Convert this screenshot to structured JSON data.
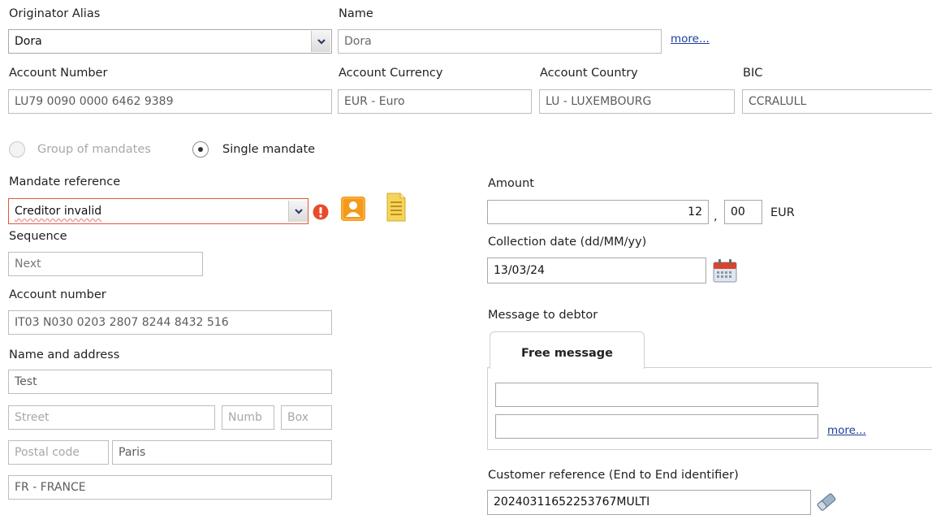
{
  "originator": {
    "alias_label": "Originator Alias",
    "alias_value": "Dora",
    "name_label": "Name",
    "name_value": "Dora",
    "more_link": "more..."
  },
  "account": {
    "number_label": "Account Number",
    "number_value": "LU79 0090 0000 6462 9389",
    "currency_label": "Account Currency",
    "currency_value": "EUR - Euro",
    "country_label": "Account Country",
    "country_value": "LU - LUXEMBOURG",
    "bic_label": "BIC",
    "bic_value": "CCRALULL"
  },
  "mandate_type": {
    "group_label": "Group of mandates",
    "single_label": "Single mandate",
    "selected": "single"
  },
  "mandate": {
    "reference_label": "Mandate reference",
    "reference_value": "Creditor invalid",
    "sequence_label": "Sequence",
    "sequence_value": "Next",
    "account_number_label": "Account number",
    "account_number_value": "IT03 N030 0203 2807 8244 8432 516",
    "name_address_label": "Name and address",
    "name_value": "Test",
    "street_placeholder": "Street",
    "number_placeholder": "Numb",
    "box_placeholder": "Box",
    "postal_placeholder": "Postal code",
    "city_value": "Paris",
    "country_value": "FR - FRANCE"
  },
  "amount": {
    "label": "Amount",
    "integer_value": "12",
    "separator": ",",
    "decimal_value": "00",
    "currency": "EUR"
  },
  "collection": {
    "label": "Collection date (dd/MM/yy)",
    "value": "13/03/24"
  },
  "message": {
    "label": "Message to debtor",
    "tab_label": "Free message",
    "line1": "",
    "line2": "",
    "more_link": "more..."
  },
  "customer_ref": {
    "label": "Customer reference (End to End identifier)",
    "value": "20240311652253767MULTI"
  },
  "colors": {
    "error_border": "#e2573b",
    "link": "#1a3e9a",
    "user_icon": "#f39a1b"
  }
}
